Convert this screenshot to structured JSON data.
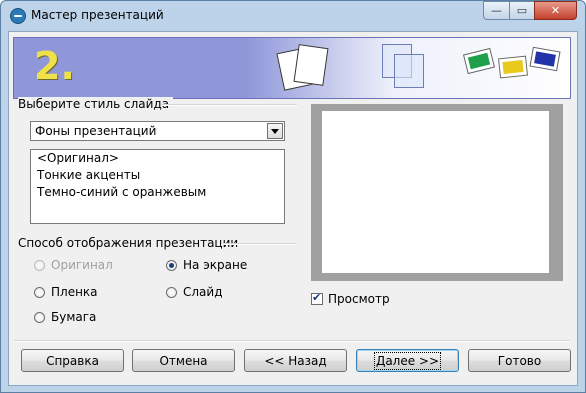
{
  "window": {
    "title": "Мастер презентаций",
    "controls": {
      "minimize": "—",
      "maximize": "▭",
      "close": "✕"
    }
  },
  "banner": {
    "step": "2."
  },
  "slide_style": {
    "group_label": "Выберите стиль слайда",
    "combo_value": "Фоны презентаций",
    "items": [
      "<Оригинал>",
      "Тонкие акценты",
      "Темно-синий с оранжевым"
    ]
  },
  "display_mode": {
    "group_label": "Способ отображения презентации",
    "options": {
      "original": "Оригинал",
      "on_screen": "На экране",
      "film": "Пленка",
      "slide": "Слайд",
      "paper": "Бумага"
    },
    "selected": "on_screen"
  },
  "preview": {
    "checkbox_label": "Просмотр",
    "checked": true
  },
  "buttons": {
    "help": "Справка",
    "cancel": "Отмена",
    "back": "<< Назад",
    "next": "Далее >>",
    "done": "Готово"
  }
}
